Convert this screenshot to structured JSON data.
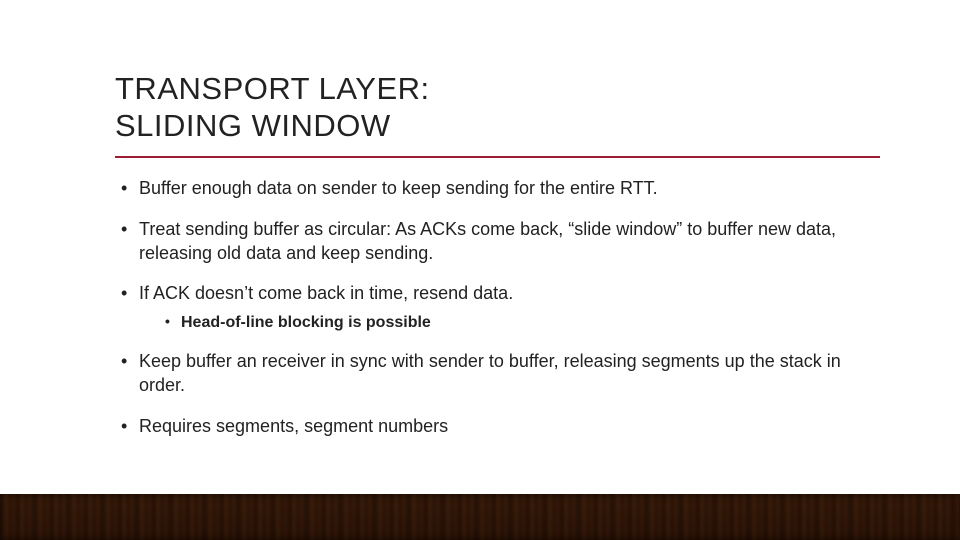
{
  "title": "TRANSPORT LAYER:\nSLIDING WINDOW",
  "bullets": [
    {
      "text": "Buffer enough data on sender to keep sending for the entire RTT."
    },
    {
      "text": "Treat sending buffer as circular: As ACKs come back, “slide window” to buffer new data, releasing old data and keep sending."
    },
    {
      "text": "If ACK doesn’t come back in time, resend data.",
      "sub": [
        {
          "text": "Head-of-line blocking is possible"
        }
      ]
    },
    {
      "text": "Keep buffer an receiver in sync with sender to buffer, releasing segments up the stack in order."
    },
    {
      "text": "Requires segments, segment numbers"
    }
  ],
  "accent_color": "#9c1c33"
}
